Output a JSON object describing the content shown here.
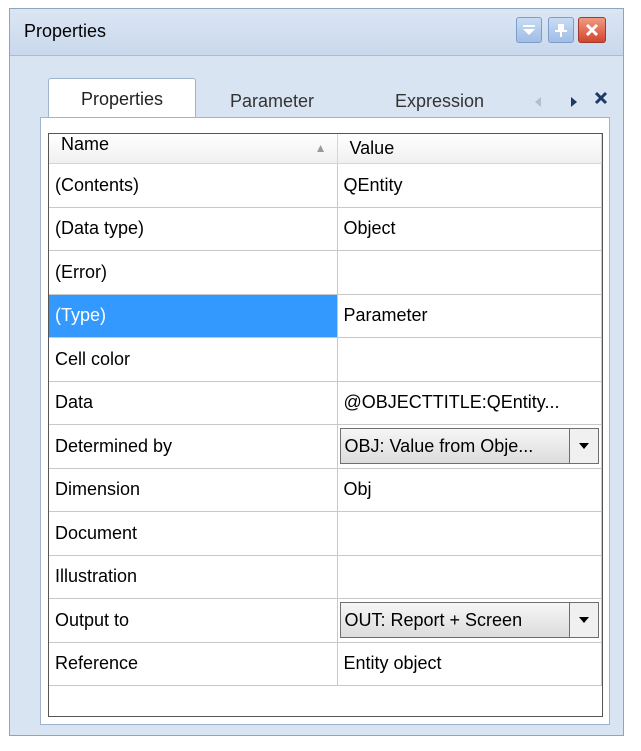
{
  "window": {
    "title": "Properties"
  },
  "tabs": [
    {
      "label": "Properties",
      "active": true
    },
    {
      "label": "Parameter",
      "active": false
    },
    {
      "label": "Expression",
      "active": false
    }
  ],
  "grid": {
    "columns": {
      "name": "Name",
      "value": "Value"
    },
    "rows": [
      {
        "name": "(Contents)",
        "value": "QEntity"
      },
      {
        "name": "(Data type)",
        "value": "Object"
      },
      {
        "name": "(Error)",
        "value": ""
      },
      {
        "name": "(Type)",
        "value": "Parameter",
        "selected": true
      },
      {
        "name": "Cell color",
        "value": ""
      },
      {
        "name": "Data",
        "value": "@OBJECTTITLE:QEntity..."
      },
      {
        "name": "Determined by",
        "value": "OBJ: Value from Obje...",
        "dropdown": true
      },
      {
        "name": "Dimension",
        "value": "Obj"
      },
      {
        "name": "Document",
        "value": ""
      },
      {
        "name": "Illustration",
        "value": ""
      },
      {
        "name": "Output to",
        "value": "OUT: Report + Screen",
        "dropdown": true
      },
      {
        "name": "Reference",
        "value": "Entity object"
      }
    ]
  },
  "colors": {
    "selection": "#3399ff",
    "frame": "#d9e4f2",
    "close_button": "#d3452c"
  }
}
